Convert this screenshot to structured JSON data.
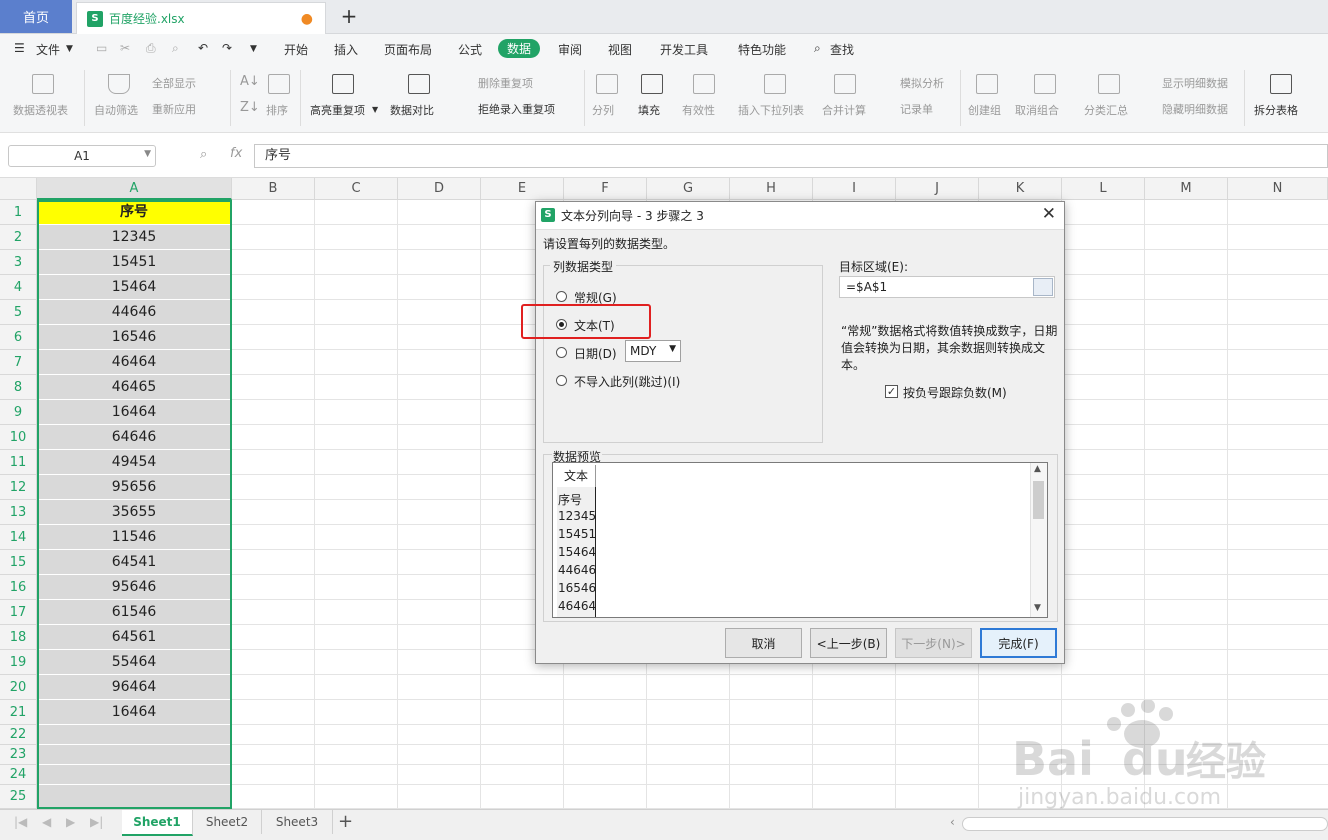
{
  "tabbar": {
    "home": "首页",
    "file_name": "百度经验.xlsx",
    "xls_icon": "S"
  },
  "menubar": {
    "file": "文件",
    "items": [
      "开始",
      "插入",
      "页面布局",
      "公式",
      "数据",
      "审阅",
      "视图",
      "开发工具",
      "特色功能"
    ],
    "search": "查找"
  },
  "ribbon": {
    "pivot": "数据透视表",
    "autofilter": "自动筛选",
    "show_all": "全部显示",
    "reapply": "重新应用",
    "sort": "排序",
    "highlight_dup": "高亮重复项",
    "compare": "数据对比",
    "remove_dup": "删除重复项",
    "reject_dup": "拒绝录入重复项",
    "split": "分列",
    "fill": "填充",
    "validity": "有效性",
    "insert_dropdown": "插入下拉列表",
    "merge_calc": "合并计算",
    "simulate": "模拟分析",
    "record": "记录单",
    "group": "创建组",
    "ungroup": "取消组合",
    "subtotal": "分类汇总",
    "show_detail": "显示明细数据",
    "hide_detail": "隐藏明细数据",
    "split_table": "拆分表格"
  },
  "formula_bar": {
    "cell_ref": "A1",
    "fx": "fx",
    "content": "序号"
  },
  "grid": {
    "columns": [
      "A",
      "B",
      "C",
      "D",
      "E",
      "F",
      "G",
      "H",
      "I",
      "J",
      "K",
      "L",
      "M",
      "N"
    ],
    "rows": [
      "1",
      "2",
      "3",
      "4",
      "5",
      "6",
      "7",
      "8",
      "9",
      "10",
      "11",
      "12",
      "13",
      "14",
      "15",
      "16",
      "17",
      "18",
      "19",
      "20",
      "21",
      "22",
      "23",
      "24",
      "25"
    ],
    "colA": [
      "序号",
      "12345",
      "15451",
      "15464",
      "44646",
      "16546",
      "46464",
      "46465",
      "16464",
      "64646",
      "49454",
      "95656",
      "35655",
      "11546",
      "64541",
      "95646",
      "61546",
      "64561",
      "55464",
      "96464",
      "16464",
      "",
      "",
      "",
      ""
    ]
  },
  "sheets": [
    "Sheet1",
    "Sheet2",
    "Sheet3"
  ],
  "dialog": {
    "title": "文本分列向导 - 3 步骤之 3",
    "prompt": "请设置每列的数据类型。",
    "group_label": "列数据类型",
    "opt_general": "常规(G)",
    "opt_text": "文本(T)",
    "opt_date": "日期(D)",
    "date_format": "MDY",
    "opt_skip": "不导入此列(跳过)(I)",
    "target_label": "目标区域(E):",
    "target_value": "=$A$1",
    "description": "“常规”数据格式将数值转换成数字，日期值会转换为日期，其余数据则转换成文本。",
    "negative_label": "按负号跟踪负数(M)",
    "preview_label": "数据预览",
    "preview_header": "文本",
    "preview_rows": [
      "序号",
      "12345",
      "15451",
      "15464",
      "44646",
      "16546",
      "46464"
    ],
    "btn_cancel": "取消",
    "btn_back": "<上一步(B)",
    "btn_next": "下一步(N)>",
    "btn_finish": "完成(F)"
  },
  "watermark": {
    "brand_a": "Bai",
    "brand_b": "du",
    "brand_c": "经验",
    "url": "jingyan.baidu.com"
  },
  "colors": {
    "accent": "#21a366",
    "home_tab": "#5b7fcd",
    "header_fill": "#ffff00",
    "highlight_box": "#e02020"
  }
}
